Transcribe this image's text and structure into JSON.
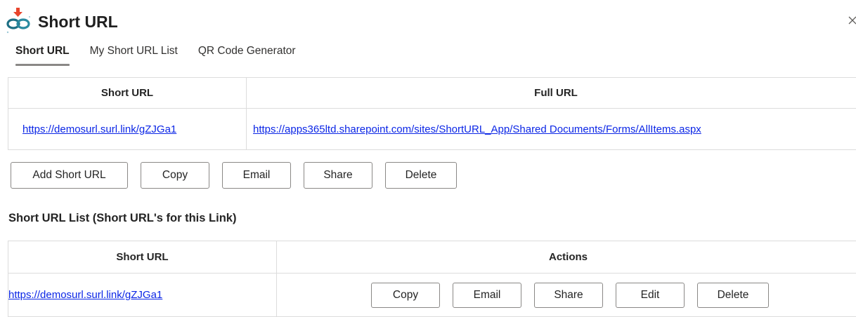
{
  "app": {
    "title": "Short URL",
    "icon": "link-chain-download-icon",
    "close_icon": "close-icon"
  },
  "tabs": [
    {
      "label": "Short URL",
      "active": true
    },
    {
      "label": "My Short URL List",
      "active": false
    },
    {
      "label": "QR Code Generator",
      "active": false
    }
  ],
  "url_table": {
    "headers": [
      "Short URL",
      "Full URL"
    ],
    "row": {
      "short_url": "https://demosurl.surl.link/gZJGa1",
      "full_url": "https://apps365ltd.sharepoint.com/sites/ShortURL_App/Shared Documents/Forms/AllItems.aspx"
    }
  },
  "toolbar": {
    "add_label": "Add Short URL",
    "copy_label": "Copy",
    "email_label": "Email",
    "share_label": "Share",
    "delete_label": "Delete"
  },
  "list_section": {
    "title": "Short URL List (Short URL's for this Link)",
    "headers": [
      "Short URL",
      "Actions"
    ],
    "rows": [
      {
        "short_url": "https://demosurl.surl.link/gZJGa1",
        "actions": {
          "copy": "Copy",
          "email": "Email",
          "share": "Share",
          "edit": "Edit",
          "delete": "Delete"
        }
      }
    ]
  },
  "colors": {
    "link": "#0b26e6",
    "border": "#dcdcdc",
    "button_border": "#8a8886",
    "icon_red": "#e8452c",
    "icon_teal": "#1d6f84"
  }
}
